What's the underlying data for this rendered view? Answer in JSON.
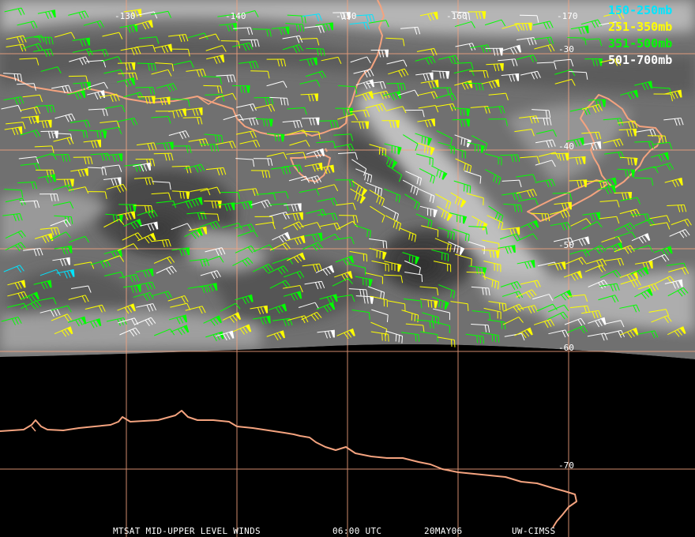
{
  "longitude_labels": [
    "-130",
    "-140",
    "-150",
    "-160",
    "-170"
  ],
  "latitude_labels": [
    "-30",
    "-40",
    "-50",
    "-60",
    "-70"
  ],
  "legend": [
    {
      "label": "150-250mb",
      "color": "#00e5ff"
    },
    {
      "label": "251-350mb",
      "color": "#ffff00"
    },
    {
      "label": "351-500mb",
      "color": "#00ff00"
    },
    {
      "label": "501-700mb",
      "color": "#ffffff"
    }
  ],
  "footer": {
    "product": "MTSAT MID-UPPER LEVEL WINDS",
    "time": "06:00 UTC",
    "date": "20MAY06",
    "source": "UW-CIMSS"
  },
  "colors": {
    "grid": "#f4a37f",
    "coast": "#f4a37f",
    "space": "#000000",
    "earth": "#7a7a7a"
  }
}
